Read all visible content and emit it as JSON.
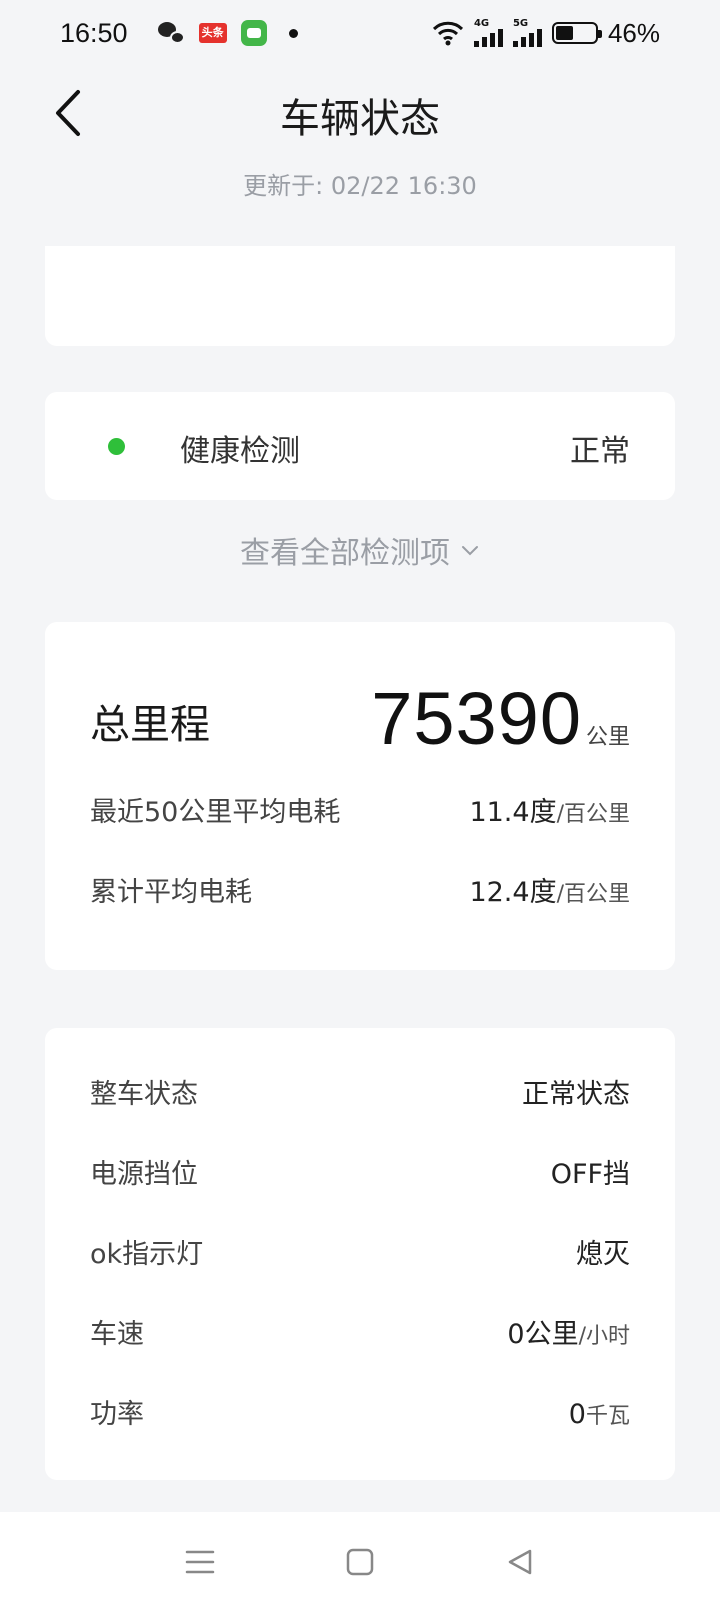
{
  "status_bar": {
    "time": "16:50",
    "toutiao_label": "头条",
    "network_1": "4G",
    "network_2": "5G",
    "battery_level": 0.46,
    "battery_pct": "46%"
  },
  "header": {
    "title": "车辆状态",
    "updated": "更新于: 02/22 16:30"
  },
  "health": {
    "label": "健康检测",
    "value": "正常",
    "status_color": "#2fbf3a"
  },
  "view_all": {
    "label": "查看全部检测项"
  },
  "mileage": {
    "total_label": "总里程",
    "total_value": "75390",
    "total_unit": "公里",
    "rows": [
      {
        "label": "最近50公里平均电耗",
        "value": "11.4度",
        "unit": "/百公里"
      },
      {
        "label": "累计平均电耗",
        "value": "12.4度",
        "unit": "/百公里"
      }
    ]
  },
  "vehicle": {
    "rows": [
      {
        "label": "整车状态",
        "value": "正常状态",
        "unit": ""
      },
      {
        "label": "电源挡位",
        "value": "OFF挡",
        "unit": ""
      },
      {
        "label": "ok指示灯",
        "value": "熄灭",
        "unit": ""
      },
      {
        "label": "车速",
        "value": "0公里",
        "unit": "/小时"
      },
      {
        "label": "功率",
        "value": "0",
        "unit": "千瓦"
      }
    ]
  },
  "nav": {
    "icons": [
      "menu-icon",
      "home-icon",
      "back-triangle-icon"
    ]
  }
}
